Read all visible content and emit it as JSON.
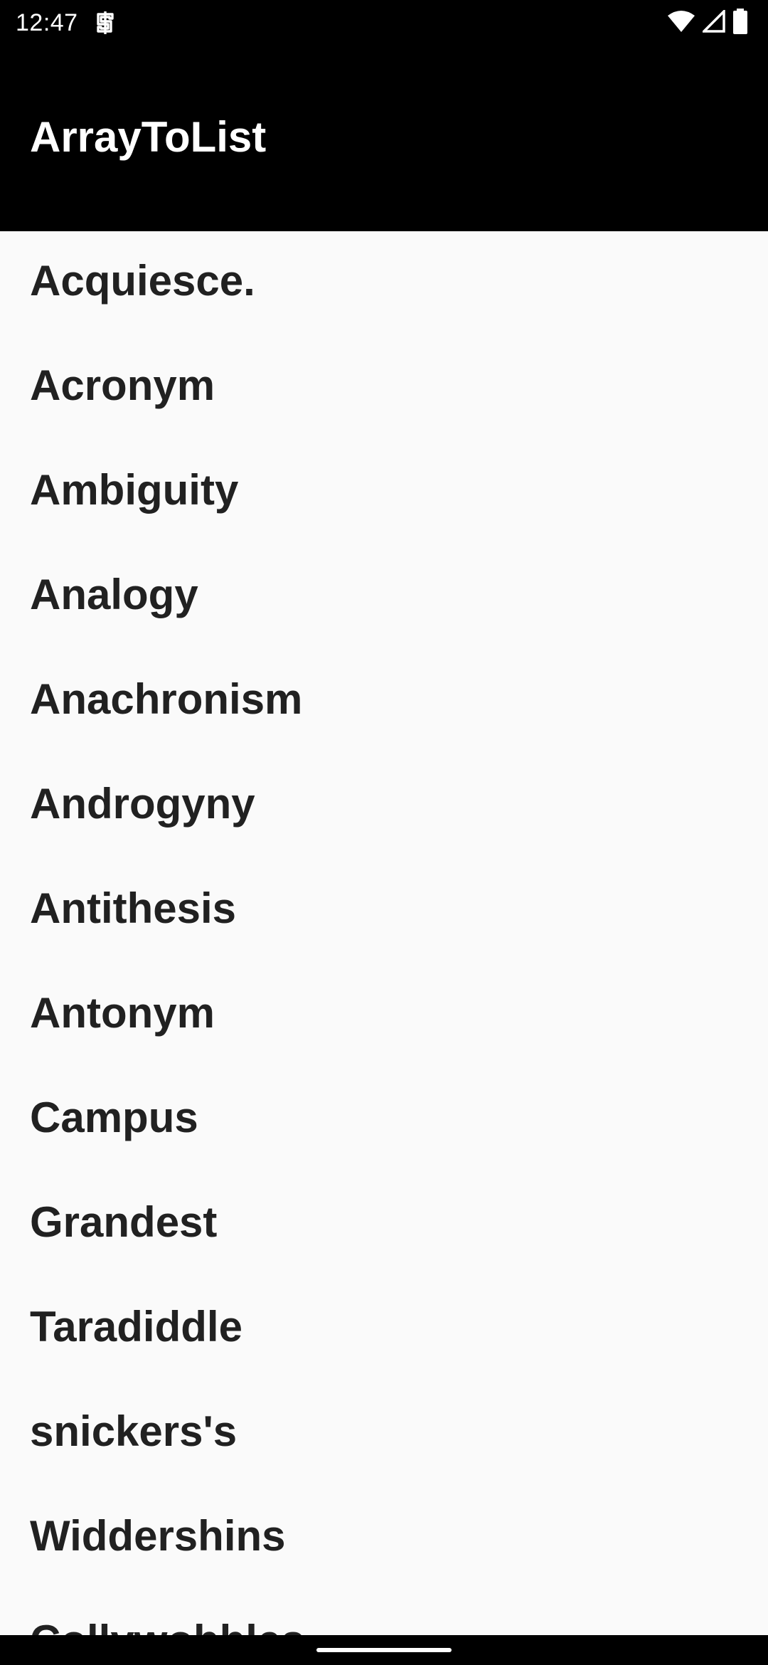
{
  "status_bar": {
    "time": "12:47",
    "icons": [
      "sync-notification-icon",
      "wifi-icon",
      "cell-signal-icon",
      "battery-icon"
    ]
  },
  "app_bar": {
    "title": "ArrayToList"
  },
  "list": {
    "items": [
      "Acquiesce.",
      "Acronym",
      "Ambiguity",
      "Analogy",
      "Anachronism",
      "Androgyny",
      "Antithesis",
      "Antonym",
      "Campus",
      "Grandest",
      "Taradiddle",
      "snickers's",
      "Widdershins",
      "Collywobbles"
    ]
  },
  "colors": {
    "app_bar_background": "#000000",
    "list_background": "#fafafa",
    "list_text": "#212121",
    "title_text": "#ffffff"
  }
}
